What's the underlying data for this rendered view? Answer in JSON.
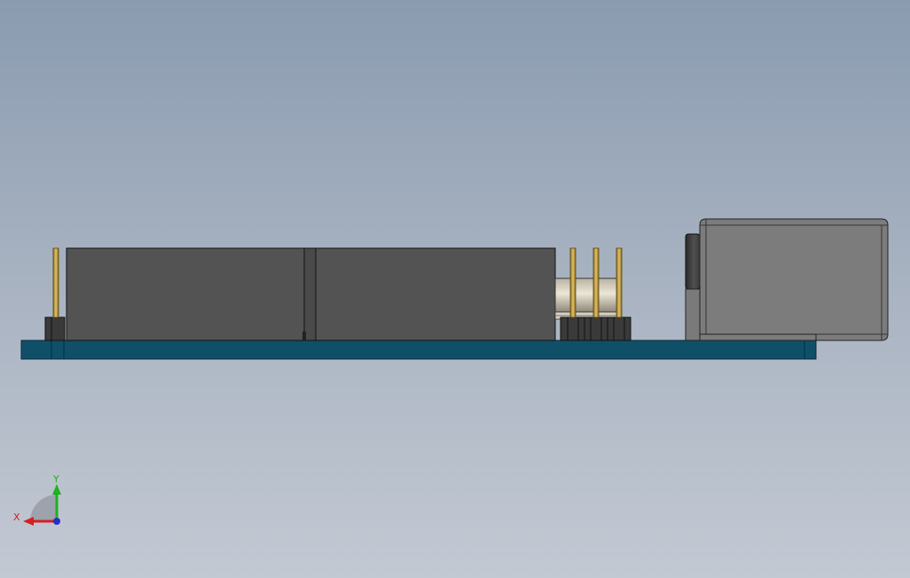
{
  "viewport": {
    "background_top": "#8a9bb0",
    "background_bottom": "#c3c9d3"
  },
  "model": {
    "pcb_color": "#0f5068",
    "component_dark_color": "#535353",
    "component_light_color": "#7c7c7c",
    "pin_color": "#c9a64a"
  },
  "triad": {
    "x_label": "X",
    "y_label": "Y",
    "x_color": "#d42020",
    "y_color": "#20b020",
    "z_color": "#2030c8"
  }
}
